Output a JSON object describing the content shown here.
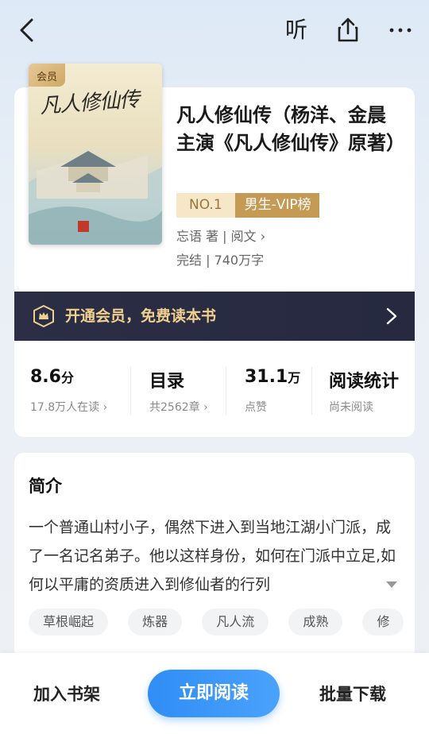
{
  "topbar": {
    "listen_label": "听",
    "icons": {
      "back": "back-arrow-icon",
      "share": "share-icon",
      "more": "more-dots-icon"
    }
  },
  "book": {
    "cover": {
      "member_tag": "会员",
      "title_art": "凡人修仙传"
    },
    "title": "凡人修仙传（杨洋、金晨主演《凡人修仙传》原著）",
    "rank_no": "NO.1",
    "rank_name": "男生-VIP榜",
    "author_line": "忘语 著 | 阅文 ›",
    "status_line": "完结 | 740万字"
  },
  "vip": {
    "text": "开通会员，免费读本书",
    "icon": "crown-badge-icon"
  },
  "stats": [
    {
      "big": "8.6",
      "unit": "分",
      "sub": "17.8万人在读 ›"
    },
    {
      "big": "目录",
      "unit": "",
      "sub": "共2562章 ›"
    },
    {
      "big": "31.1",
      "unit": "万",
      "sub": "点赞"
    },
    {
      "big": "阅读统计",
      "unit": "",
      "sub": "尚未阅读"
    }
  ],
  "intro": {
    "title": "简介",
    "text": "一个普通山村小子，偶然下进入到当地江湖小门派，成了一名记名弟子。他以这样身份，如何在门派中立足,如何以平庸的资质进入到修仙者的行列",
    "tags": [
      "草根崛起",
      "炼器",
      "凡人流",
      "成熟",
      "修"
    ]
  },
  "bottom": {
    "add_shelf": "加入书架",
    "read_now": "立即阅读",
    "batch_download": "批量下载"
  },
  "colors": {
    "accent": "#2f8df5",
    "gold": "#c59a55",
    "vip_bg": "#2b2e44"
  }
}
